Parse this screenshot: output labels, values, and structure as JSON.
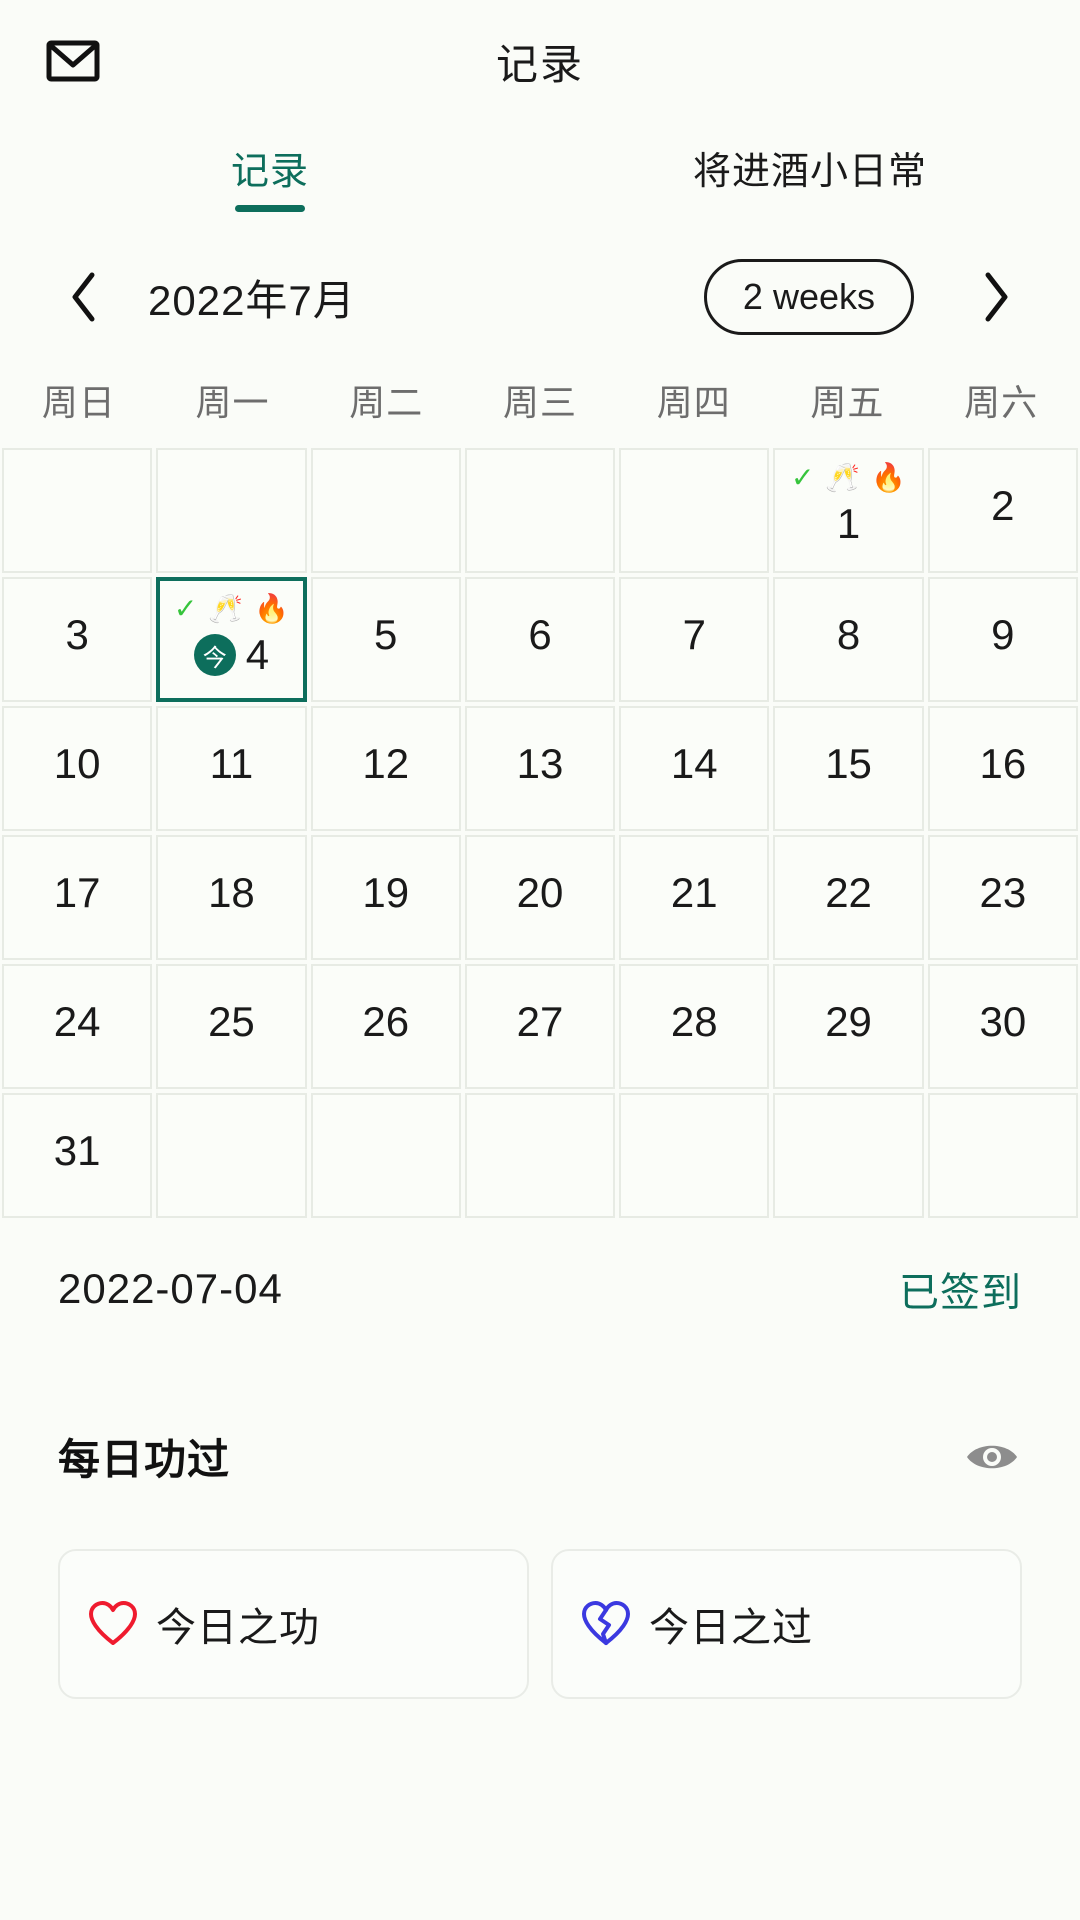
{
  "appbar": {
    "title": "记录",
    "mail_icon": "mail-icon"
  },
  "tabs": [
    {
      "label": "记录",
      "active": true
    },
    {
      "label": "将进酒小日常",
      "active": false
    }
  ],
  "monthnav": {
    "prev_icon": "chevron-left-icon",
    "next_icon": "chevron-right-icon",
    "month_label": "2022年7月",
    "range_label": "2 weeks"
  },
  "weekdays": [
    "周日",
    "周一",
    "周二",
    "周三",
    "周四",
    "周五",
    "周六"
  ],
  "calendar": {
    "leading_blanks": 5,
    "trailing_blanks": 6,
    "days": [
      {
        "num": "1",
        "icons": [
          "check",
          "clink",
          "fire"
        ],
        "selected": false,
        "today": false
      },
      {
        "num": "2",
        "icons": [],
        "selected": false,
        "today": false
      },
      {
        "num": "3",
        "icons": [],
        "selected": false,
        "today": false
      },
      {
        "num": "4",
        "icons": [
          "check",
          "clink",
          "fire"
        ],
        "selected": true,
        "today": true,
        "today_label": "今"
      },
      {
        "num": "5",
        "icons": [],
        "selected": false,
        "today": false
      },
      {
        "num": "6",
        "icons": [],
        "selected": false,
        "today": false
      },
      {
        "num": "7",
        "icons": [],
        "selected": false,
        "today": false
      },
      {
        "num": "8",
        "icons": [],
        "selected": false,
        "today": false
      },
      {
        "num": "9",
        "icons": [],
        "selected": false,
        "today": false
      },
      {
        "num": "10",
        "icons": [],
        "selected": false,
        "today": false
      },
      {
        "num": "11",
        "icons": [],
        "selected": false,
        "today": false
      },
      {
        "num": "12",
        "icons": [],
        "selected": false,
        "today": false
      },
      {
        "num": "13",
        "icons": [],
        "selected": false,
        "today": false
      },
      {
        "num": "14",
        "icons": [],
        "selected": false,
        "today": false
      },
      {
        "num": "15",
        "icons": [],
        "selected": false,
        "today": false
      },
      {
        "num": "16",
        "icons": [],
        "selected": false,
        "today": false
      },
      {
        "num": "17",
        "icons": [],
        "selected": false,
        "today": false
      },
      {
        "num": "18",
        "icons": [],
        "selected": false,
        "today": false
      },
      {
        "num": "19",
        "icons": [],
        "selected": false,
        "today": false
      },
      {
        "num": "20",
        "icons": [],
        "selected": false,
        "today": false
      },
      {
        "num": "21",
        "icons": [],
        "selected": false,
        "today": false
      },
      {
        "num": "22",
        "icons": [],
        "selected": false,
        "today": false
      },
      {
        "num": "23",
        "icons": [],
        "selected": false,
        "today": false
      },
      {
        "num": "24",
        "icons": [],
        "selected": false,
        "today": false
      },
      {
        "num": "25",
        "icons": [],
        "selected": false,
        "today": false
      },
      {
        "num": "26",
        "icons": [],
        "selected": false,
        "today": false
      },
      {
        "num": "27",
        "icons": [],
        "selected": false,
        "today": false
      },
      {
        "num": "28",
        "icons": [],
        "selected": false,
        "today": false
      },
      {
        "num": "29",
        "icons": [],
        "selected": false,
        "today": false
      },
      {
        "num": "30",
        "icons": [],
        "selected": false,
        "today": false
      },
      {
        "num": "31",
        "icons": [],
        "selected": false,
        "today": false
      }
    ],
    "icon_glyphs": {
      "check": "✓",
      "clink": "🥂",
      "fire": "🔥"
    }
  },
  "selected_date": {
    "date_text": "2022-07-04",
    "checkin_status": "已签到"
  },
  "merit_section": {
    "title": "每日功过",
    "eye_icon": "eye-icon",
    "cards": [
      {
        "label": "今日之功",
        "icon": "heart-icon",
        "color": "#ef1b2e"
      },
      {
        "label": "今日之过",
        "icon": "broken-heart-icon",
        "color": "#3b39e0"
      }
    ]
  },
  "colors": {
    "accent": "#0d6e5c",
    "background": "#fafcf8",
    "cell_border": "#e7ebe4",
    "text": "#1a1a1a",
    "muted_text": "#6d6d6d",
    "check_green": "#36c43c",
    "fire_red": "#e0342a"
  }
}
